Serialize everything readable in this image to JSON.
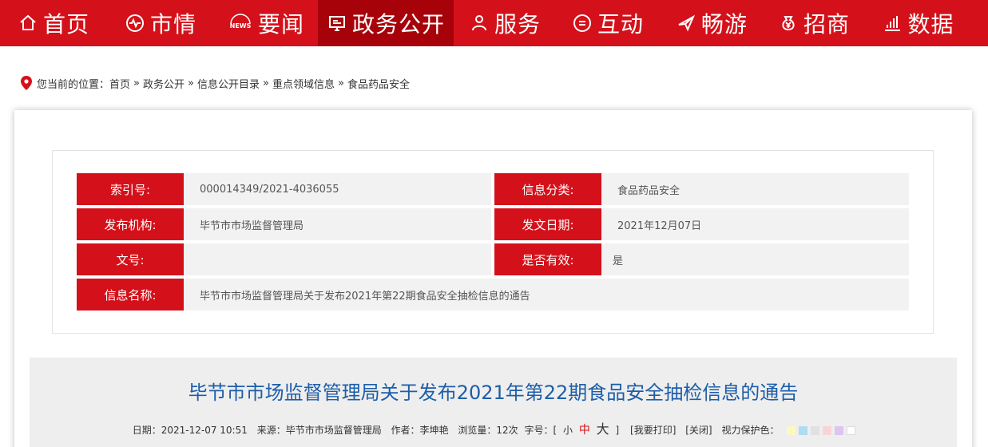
{
  "nav": {
    "items": [
      {
        "label": "首页",
        "icon": "home-icon"
      },
      {
        "label": "市情",
        "icon": "pulse-icon"
      },
      {
        "label": "要闻",
        "icon": "news-icon",
        "icon_text": "NEWS"
      },
      {
        "label": "政务公开",
        "icon": "monitor-icon",
        "active": true
      },
      {
        "label": "服务",
        "icon": "people-icon"
      },
      {
        "label": "互动",
        "icon": "chat-icon"
      },
      {
        "label": "畅游",
        "icon": "plane-icon"
      },
      {
        "label": "招商",
        "icon": "yen-bag-icon"
      },
      {
        "label": "数据",
        "icon": "bar-chart-icon"
      }
    ],
    "bg_color": "#d4111a",
    "active_color": "#a7020a"
  },
  "breadcrumb": {
    "prefix": "您当前的位置：",
    "items": [
      "首页",
      "政务公开",
      "信息公开目录",
      "重点领域信息",
      "食品药品安全"
    ],
    "separator": "»"
  },
  "info": {
    "index_label": "索引号:",
    "index_value": "000014349/2021-4036055",
    "category_label": "信息分类:",
    "category_value": "食品药品安全",
    "publisher_label": "发布机构:",
    "publisher_value": "毕节市市场监督管理局",
    "date_label": "发文日期:",
    "date_value": "2021年12月07日",
    "docno_label": "文号:",
    "docno_value": "",
    "valid_label": "是否有效:",
    "valid_value": "是",
    "name_label": "信息名称:",
    "name_value": "毕节市市场监督管理局关于发布2021年第22期食品安全抽检信息的通告"
  },
  "article": {
    "title": "毕节市市场监督管理局关于发布2021年第22期食品安全抽检信息的通告",
    "date": "日期：2021-12-07 10:51",
    "source": "来源：毕节市市场监督管理局",
    "author": "作者：李坤艳",
    "views": "浏览量：12次",
    "font_size_prefix": "字号：[",
    "font_small": "小",
    "font_medium": "中",
    "font_large": "大",
    "font_size_suffix": "]",
    "print": "[我要打印]",
    "close": "[关闭]",
    "eye_color_label": "视力保护色：",
    "swatches": [
      "#fcf8c4",
      "#aedcf0",
      "#e1e1e1",
      "#f8d4d8",
      "#dcc6f0",
      "#ffffff"
    ]
  }
}
